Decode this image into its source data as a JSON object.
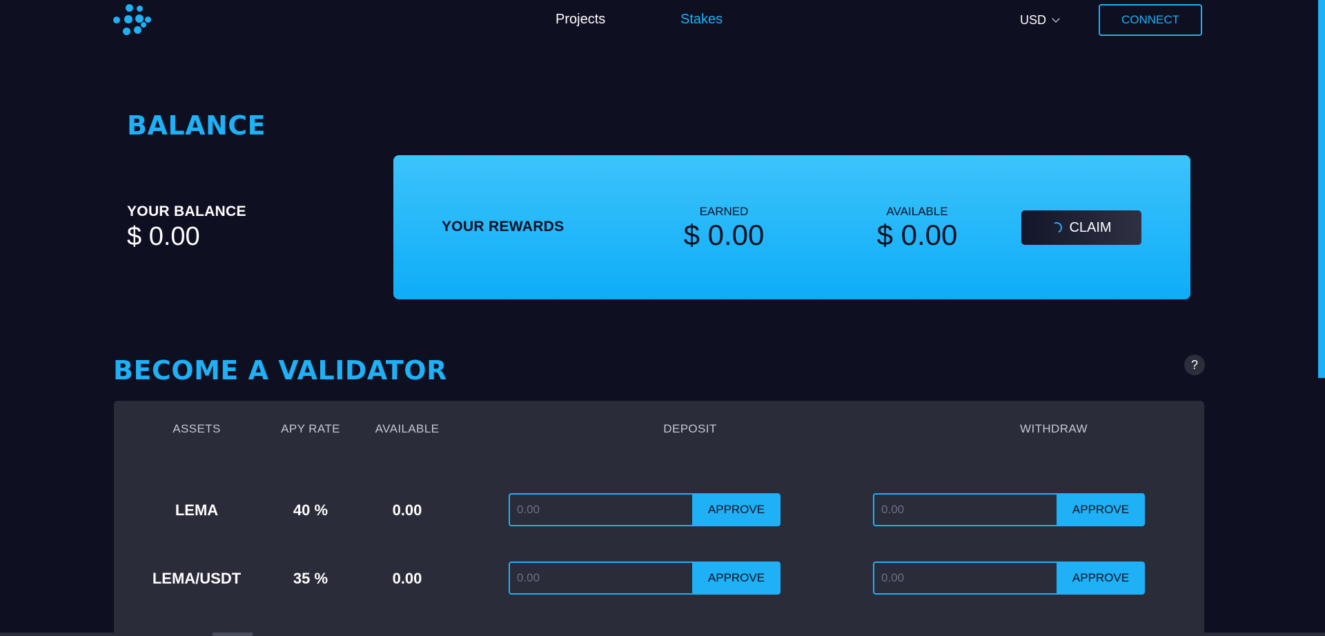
{
  "header": {
    "nav": {
      "projects": "Projects",
      "stakes": "Stakes"
    },
    "currency": "USD",
    "connect_label": "CONNECT"
  },
  "balance": {
    "title": "BALANCE",
    "your_balance_label": "YOUR BALANCE",
    "your_balance_value": "$ 0.00"
  },
  "rewards": {
    "label": "YOUR REWARDS",
    "earned_label": "EARNED",
    "earned_value": "$ 0.00",
    "available_label": "AVAILABLE",
    "available_value": "$ 0.00",
    "claim_label": "CLAIM"
  },
  "validator": {
    "title": "BECOME A VALIDATOR",
    "help": "?",
    "headers": {
      "assets": "ASSETS",
      "apy": "APY RATE",
      "available": "AVAILABLE",
      "deposit": "DEPOSIT",
      "withdraw": "WITHDRAW"
    },
    "rows": [
      {
        "asset": "LEMA",
        "apy": "40 %",
        "available": "0.00",
        "deposit_placeholder": "0.00",
        "deposit_button": "APPROVE",
        "withdraw_placeholder": "0.00",
        "withdraw_button": "APPROVE"
      },
      {
        "asset": "LEMA/USDT",
        "apy": "35 %",
        "available": "0.00",
        "deposit_placeholder": "0.00",
        "deposit_button": "APPROVE",
        "withdraw_placeholder": "0.00",
        "withdraw_button": "APPROVE"
      }
    ]
  },
  "colors": {
    "accent": "#1fb0f5",
    "background": "#0e1022",
    "card": "#2a2c3a"
  },
  "icons": {
    "logo": "dots-logo-icon",
    "currency_chevron": "chevron-down-icon",
    "help": "question-icon",
    "claim_spinner": "spinner-icon"
  }
}
